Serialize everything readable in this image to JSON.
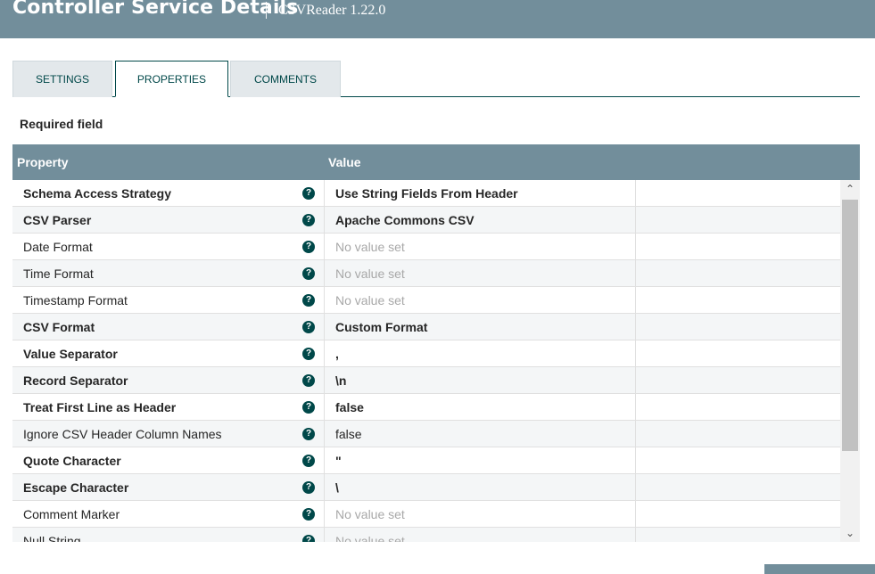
{
  "header": {
    "title": "Controller Service Details",
    "subtitle": "CSVReader 1.22.0"
  },
  "tabs": [
    {
      "label": "SETTINGS",
      "active": false
    },
    {
      "label": "PROPERTIES",
      "active": true
    },
    {
      "label": "COMMENTS",
      "active": false
    }
  ],
  "required_label": "Required field",
  "grid": {
    "columns": [
      "Property",
      "Value"
    ],
    "rows": [
      {
        "name": "Schema Access Strategy",
        "value": "Use String Fields From Header",
        "required": true,
        "empty": false
      },
      {
        "name": "CSV Parser",
        "value": "Apache Commons CSV",
        "required": true,
        "empty": false
      },
      {
        "name": "Date Format",
        "value": "No value set",
        "required": false,
        "empty": true
      },
      {
        "name": "Time Format",
        "value": "No value set",
        "required": false,
        "empty": true
      },
      {
        "name": "Timestamp Format",
        "value": "No value set",
        "required": false,
        "empty": true
      },
      {
        "name": "CSV Format",
        "value": "Custom Format",
        "required": true,
        "empty": false
      },
      {
        "name": "Value Separator",
        "value": ",",
        "required": true,
        "empty": false
      },
      {
        "name": "Record Separator",
        "value": "\\n",
        "required": true,
        "empty": false
      },
      {
        "name": "Treat First Line as Header",
        "value": "false",
        "required": true,
        "empty": false
      },
      {
        "name": "Ignore CSV Header Column Names",
        "value": "false",
        "required": false,
        "empty": false
      },
      {
        "name": "Quote Character",
        "value": "\"",
        "required": true,
        "empty": false
      },
      {
        "name": "Escape Character",
        "value": "\\",
        "required": true,
        "empty": false
      },
      {
        "name": "Comment Marker",
        "value": "No value set",
        "required": false,
        "empty": true
      },
      {
        "name": "Null String",
        "value": "No value set",
        "required": false,
        "empty": true
      }
    ]
  },
  "icons": {
    "help": "help-circle-icon",
    "scroll_up": "chevron-up-icon",
    "scroll_down": "chevron-down-icon"
  },
  "colors": {
    "header_bg": "#728e9b",
    "accent": "#004849",
    "empty_value": "#a8a8a8"
  }
}
